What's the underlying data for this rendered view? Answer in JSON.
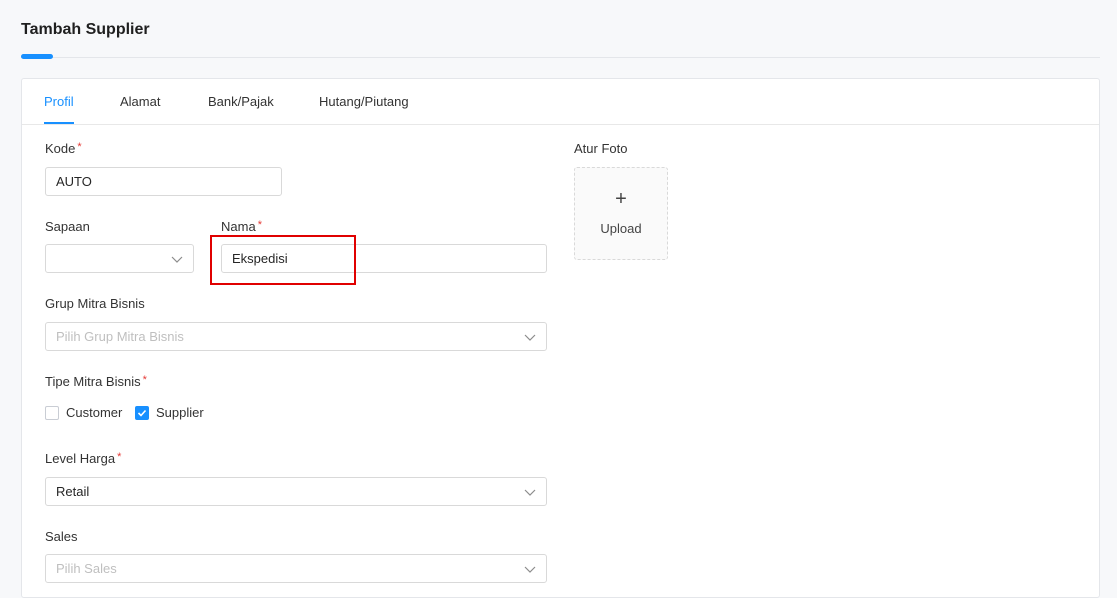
{
  "page": {
    "title": "Tambah Supplier"
  },
  "tabs": [
    {
      "label": "Profil",
      "active": true
    },
    {
      "label": "Alamat",
      "active": false
    },
    {
      "label": "Bank/Pajak",
      "active": false
    },
    {
      "label": "Hutang/Piutang",
      "active": false
    }
  ],
  "form": {
    "kode": {
      "label": "Kode",
      "required": "*",
      "value": "AUTO"
    },
    "sapaan": {
      "label": "Sapaan",
      "value": "",
      "icon": "chevron-down-icon"
    },
    "nama": {
      "label": "Nama",
      "required": "*",
      "value": "Ekspedisi"
    },
    "grup_mitra": {
      "label": "Grup Mitra Bisnis",
      "placeholder": "Pilih Grup Mitra Bisnis",
      "icon": "chevron-down-icon"
    },
    "tipe_mitra": {
      "label": "Tipe Mitra Bisnis",
      "required": "*",
      "options": [
        {
          "label": "Customer",
          "checked": false
        },
        {
          "label": "Supplier",
          "checked": true
        }
      ]
    },
    "level_harga": {
      "label": "Level Harga",
      "required": "*",
      "value": "Retail",
      "icon": "chevron-down-icon"
    },
    "sales": {
      "label": "Sales",
      "placeholder": "Pilih Sales",
      "icon": "chevron-down-icon"
    }
  },
  "photo": {
    "label": "Atur Foto",
    "plus": "+",
    "upload_label": "Upload"
  },
  "colors": {
    "accent": "#1890ff",
    "required": "#e53935",
    "highlight": "#e00000"
  }
}
